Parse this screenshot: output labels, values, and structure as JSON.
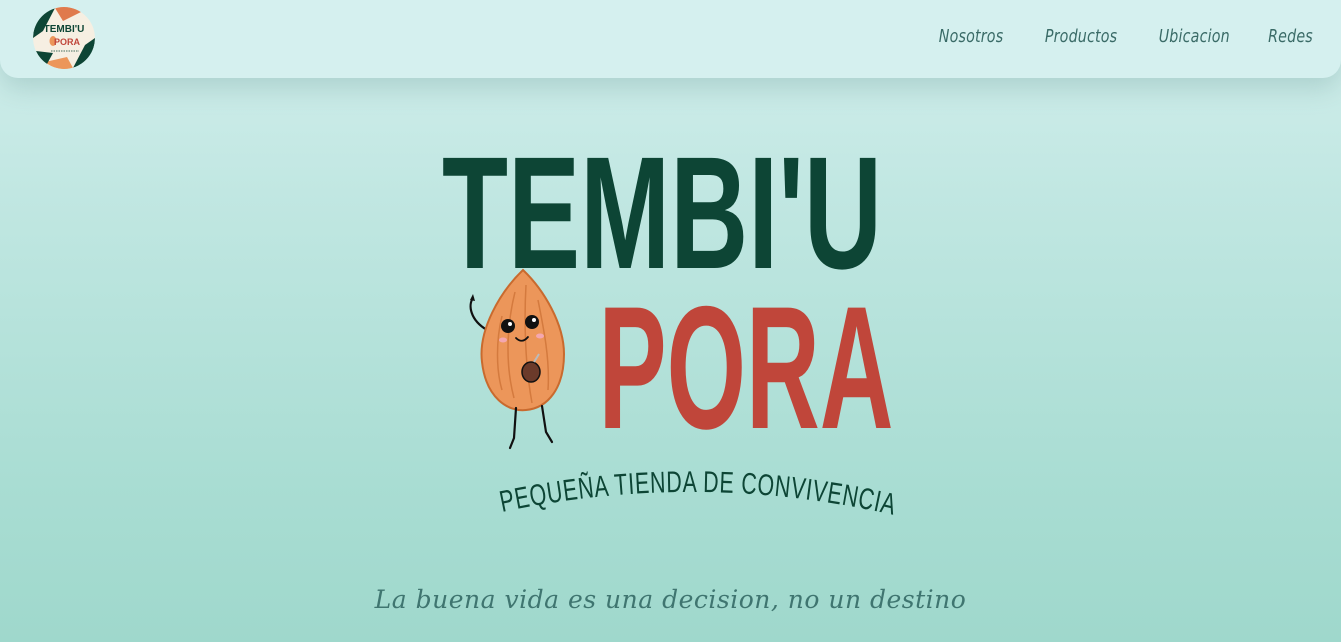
{
  "brand": {
    "name_line1": "TEMBI'U",
    "name_line2": "PORA",
    "subtitle": "PEQUEÑA TIENDA DE CONVIVENCIA",
    "logo_icon": "almond-mascot-icon"
  },
  "nav": {
    "links": [
      "Nosotros",
      "Productos",
      "Ubicacion",
      "Redes"
    ]
  },
  "hero": {
    "tagline": "La buena vida es una decision, no un destino"
  },
  "colors": {
    "dark_green": "#0d4535",
    "brick_red": "#c0463a",
    "almond_orange": "#ec965a",
    "navbar_bg": "#d5f0ef",
    "nav_text": "#3a6b67"
  }
}
